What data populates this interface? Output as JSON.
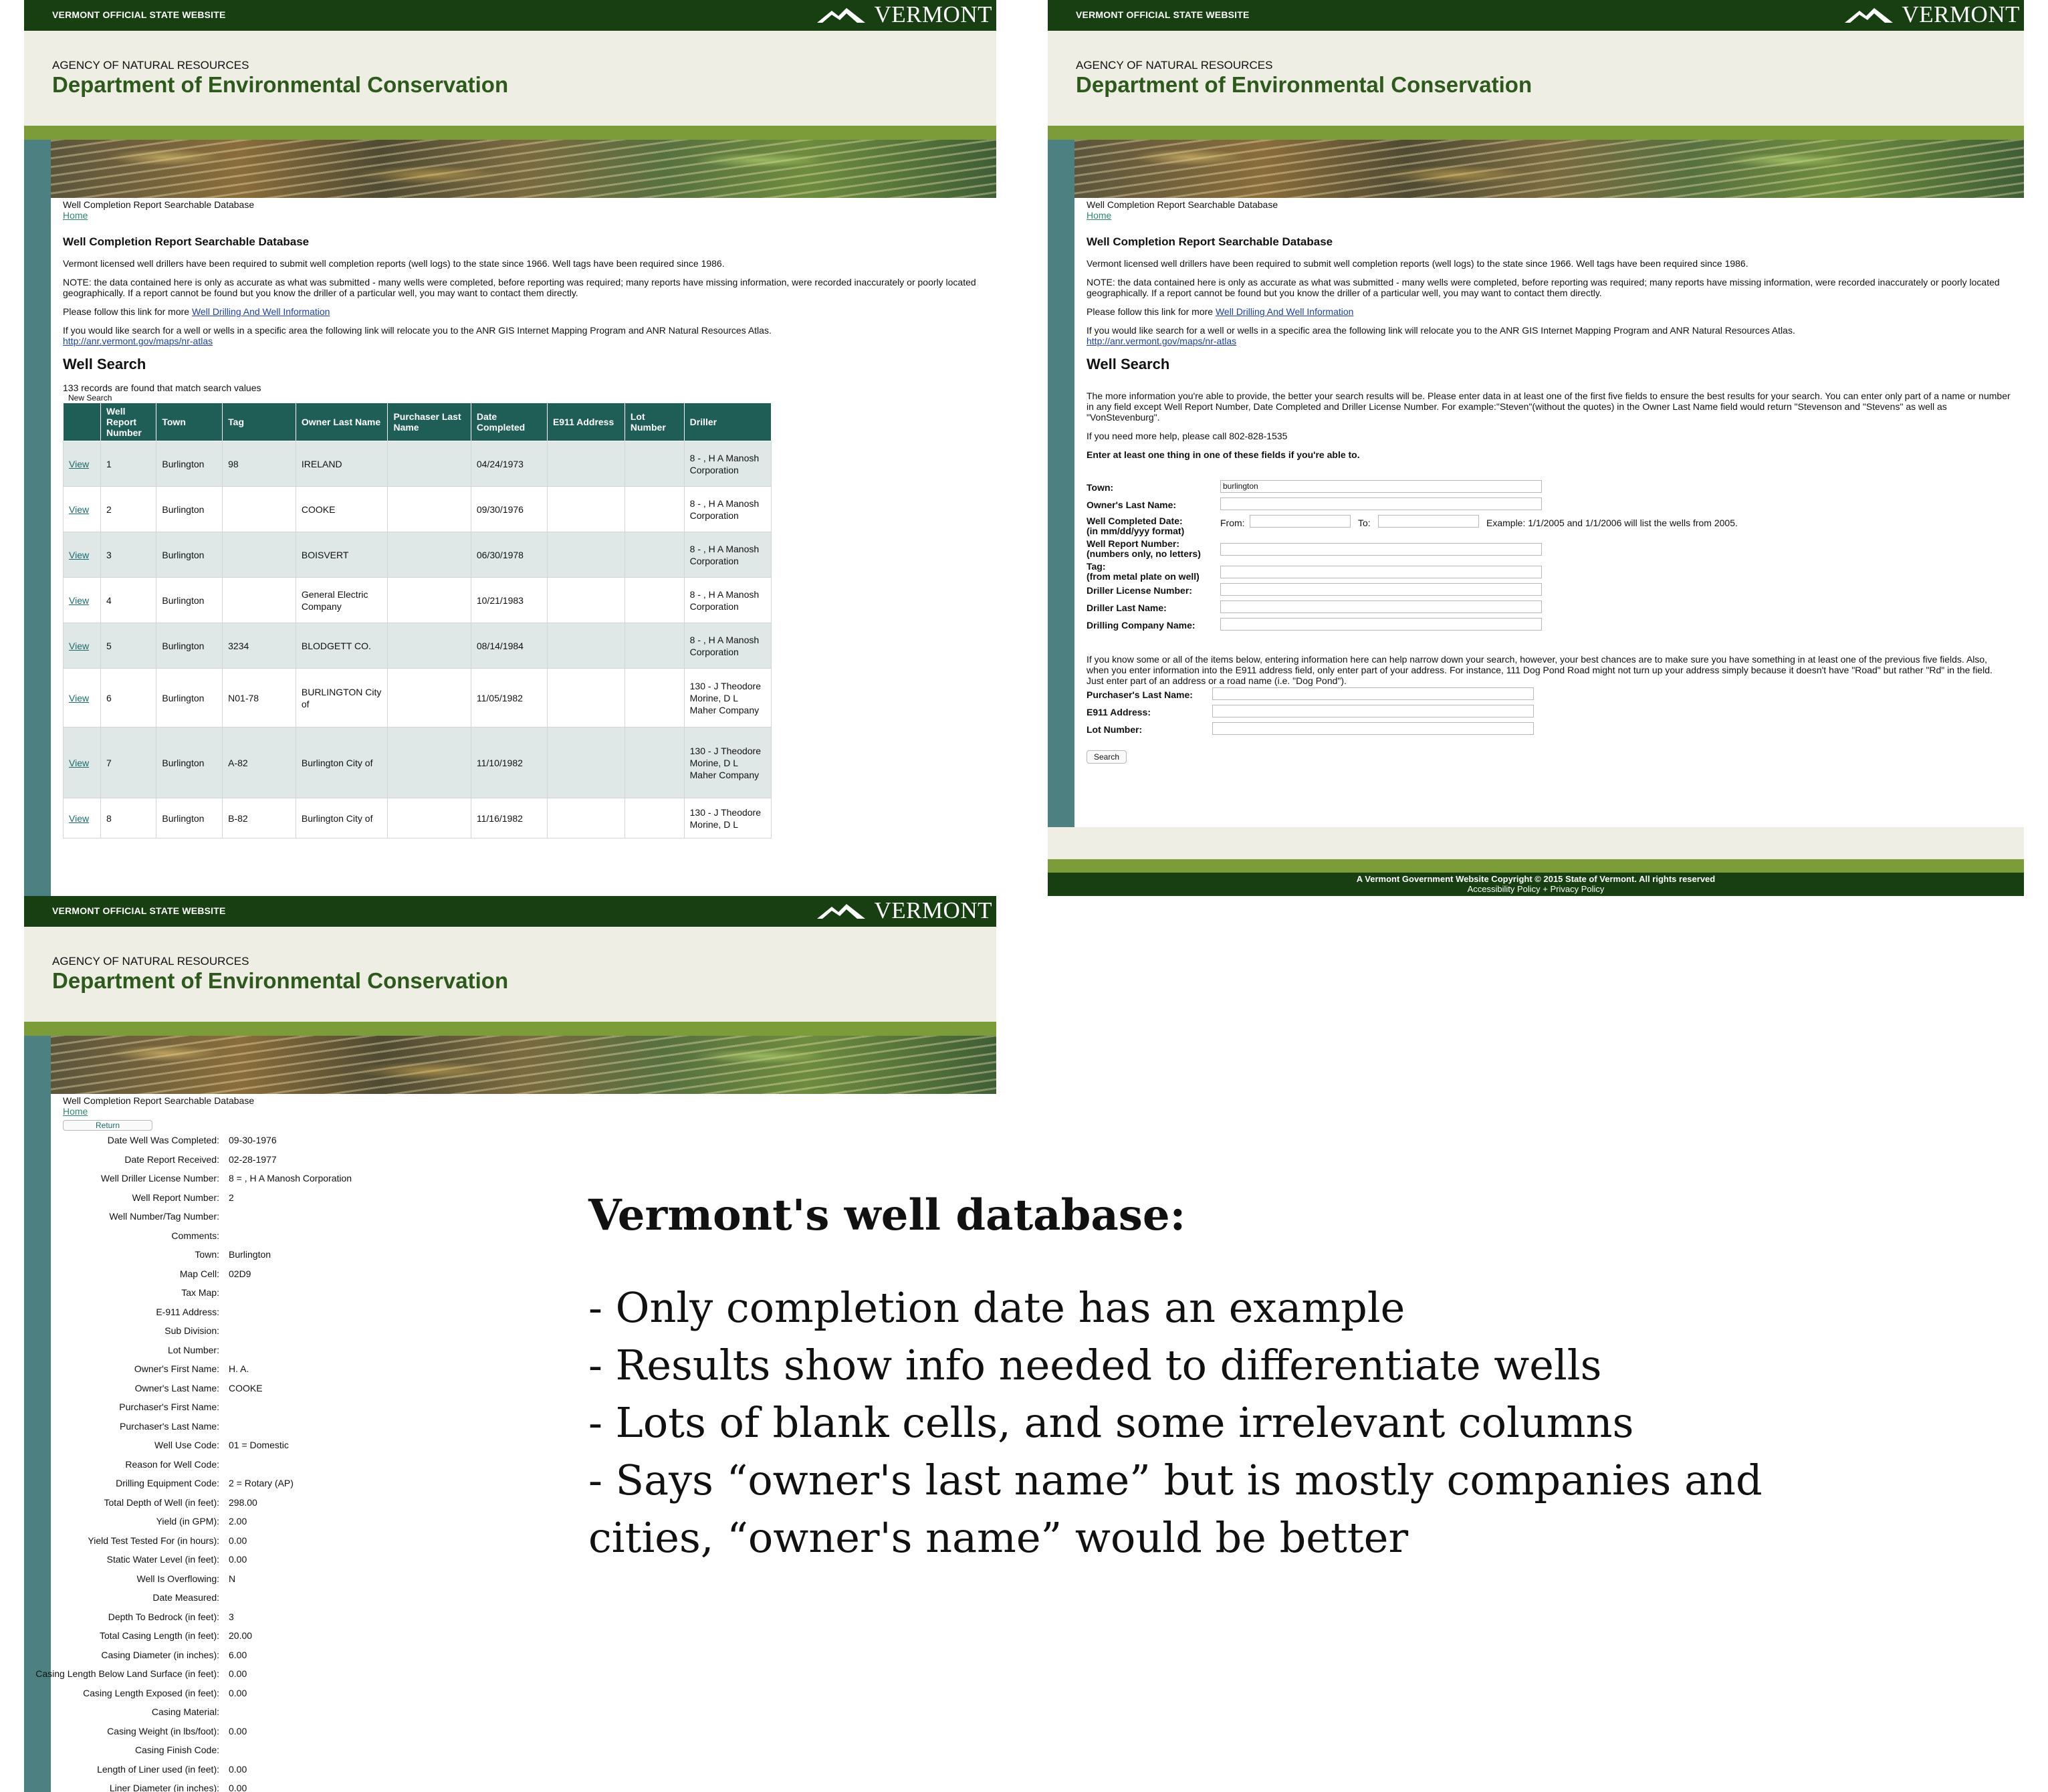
{
  "site": {
    "official": "VERMONT OFFICIAL STATE WEBSITE",
    "logo": "VERMONT",
    "agency": "AGENCY OF NATURAL RESOURCES",
    "dept": "Department of Environmental Conservation",
    "breadcrumb": "Well Completion Report Searchable Database",
    "home": "Home"
  },
  "intro": {
    "title": "Well Completion Report Searchable Database",
    "p1": "Vermont licensed well drillers have been required to submit well completion reports (well logs) to the state since 1966. Well tags have been required since 1986.",
    "p2": "NOTE: the data contained here is only as accurate as what was submitted - many wells were completed, before reporting was required; many reports have missing information, were recorded inaccurately or poorly located geographically. If a report cannot be found but you know the driller of a particular well, you may want to contact them directly.",
    "p3_pre": "Please follow this link for more ",
    "p3_link": "Well Drilling And Well Information",
    "p4": "If you would like search for a well or wells in a specific area the following link will relocate you to the ANR GIS Internet Mapping Program and ANR Natural Resources Atlas.",
    "p4_link": "http://anr.vermont.gov/maps/nr-atlas",
    "well_search": "Well Search"
  },
  "results": {
    "count_text": "133 records are found that match search values",
    "new_search": "New Search",
    "columns": [
      "",
      "Well Report Number",
      "Town",
      "Tag",
      "Owner Last Name",
      "Purchaser Last Name",
      "Date Completed",
      "E911 Address",
      "Lot Number",
      "Driller"
    ],
    "rows": [
      {
        "view": "View",
        "num": "1",
        "town": "Burlington",
        "tag": "98",
        "owner": "IRELAND",
        "purch": "",
        "date": "04/24/1973",
        "e911": "",
        "lot": "",
        "driller": "8 - , H A Manosh Corporation"
      },
      {
        "view": "View",
        "num": "2",
        "town": "Burlington",
        "tag": "",
        "owner": "COOKE",
        "purch": "",
        "date": "09/30/1976",
        "e911": "",
        "lot": "",
        "driller": "8 - , H A Manosh Corporation"
      },
      {
        "view": "View",
        "num": "3",
        "town": "Burlington",
        "tag": "",
        "owner": "BOISVERT",
        "purch": "",
        "date": "06/30/1978",
        "e911": "",
        "lot": "",
        "driller": "8 - , H A Manosh Corporation"
      },
      {
        "view": "View",
        "num": "4",
        "town": "Burlington",
        "tag": "",
        "owner": "General Electric Company",
        "purch": "",
        "date": "10/21/1983",
        "e911": "",
        "lot": "",
        "driller": "8 - , H A Manosh Corporation"
      },
      {
        "view": "View",
        "num": "5",
        "town": "Burlington",
        "tag": "3234",
        "owner": "BLODGETT CO.",
        "purch": "",
        "date": "08/14/1984",
        "e911": "",
        "lot": "",
        "driller": "8 - , H A Manosh Corporation"
      },
      {
        "view": "View",
        "num": "6",
        "town": "Burlington",
        "tag": "N01-78",
        "owner": "BURLINGTON City of",
        "purch": "",
        "date": "11/05/1982",
        "e911": "",
        "lot": "",
        "driller": "130 - J Theodore Morine, D L Maher Company"
      },
      {
        "view": "View",
        "num": "7",
        "town": "Burlington",
        "tag": "A-82",
        "owner": "Burlington City of",
        "purch": "",
        "date": "11/10/1982",
        "e911": "",
        "lot": "",
        "driller": "130 - J Theodore Morine, D L Maher Company"
      },
      {
        "view": "View",
        "num": "8",
        "town": "Burlington",
        "tag": "B-82",
        "owner": "Burlington City of",
        "purch": "",
        "date": "11/16/1982",
        "e911": "",
        "lot": "",
        "driller": "130 - J Theodore Morine, D L"
      }
    ]
  },
  "search_form": {
    "help1": "The more information you're able to provide, the better your search results will be. Please enter data in at least one of the first five fields to ensure the best results for your search. You can enter only part of a name or number in any field except Well Report Number, Date Completed and Driller License Number. For example:\"Steven\"(without the quotes) in the Owner Last Name field would return \"Stevenson and \"Stevens\" as well as \"VonStevenburg\".",
    "help2": "If you need more help, please call 802-828-1535",
    "help3": "Enter at least one thing in one of these fields if you're able to.",
    "town_label": "Town:",
    "town_value": "burlington",
    "owner_label": "Owner's Last Name:",
    "date_label": "Well Completed Date:",
    "date_label2": "(in mm/dd/yyy format)",
    "from_label": "From:",
    "to_label": "To:",
    "date_example": "Example: 1/1/2005 and 1/1/2006 will list the wells from 2005.",
    "report_label": "Well Report Number:",
    "report_label2": "(numbers only, no letters)",
    "tag_label": "Tag:",
    "tag_label2": "(from metal plate on well)",
    "license_label": "Driller License Number:",
    "driller_label": "Driller Last Name:",
    "company_label": "Drilling Company Name:",
    "help4": "If you know some or all of the items below, entering information here can help narrow down your search, however, your best chances are to make sure you have something in at least one of the previous five fields. Also, when you enter information into the E911 address field, only enter part of your address. For instance, 111 Dog Pond Road might not turn up your address simply because it doesn't have \"Road\" but rather \"Rd\" in the field. Just enter part of an address or a road name (i.e. \"Dog Pond\").",
    "purchaser_label": "Purchaser's Last Name:",
    "e911_label": "E911 Address:",
    "lot_label": "Lot Number:",
    "search_button": "Search",
    "footer1": "A Vermont Government Website Copyright © 2015 State of Vermont. All rights reserved",
    "footer2": "Accessibility Policy + Privacy Policy"
  },
  "detail": {
    "return": "Return",
    "fields": [
      {
        "label": "Date Well Was Completed:",
        "value": "09-30-1976"
      },
      {
        "label": "Date Report Received:",
        "value": "02-28-1977"
      },
      {
        "label": "Well Driller License Number:",
        "value": "8 = , H A Manosh Corporation"
      },
      {
        "label": "Well Report Number:",
        "value": "2"
      },
      {
        "label": "Well Number/Tag Number:",
        "value": ""
      },
      {
        "label": "Comments:",
        "value": ""
      },
      {
        "label": "Town:",
        "value": "Burlington"
      },
      {
        "label": "Map Cell:",
        "value": "02D9"
      },
      {
        "label": "Tax Map:",
        "value": ""
      },
      {
        "label": "E-911 Address:",
        "value": ""
      },
      {
        "label": "Sub Division:",
        "value": ""
      },
      {
        "label": "Lot Number:",
        "value": ""
      },
      {
        "label": "Owner's First Name:",
        "value": "H. A."
      },
      {
        "label": "Owner's Last Name:",
        "value": "COOKE"
      },
      {
        "label": "Purchaser's First Name:",
        "value": ""
      },
      {
        "label": "Purchaser's Last Name:",
        "value": ""
      },
      {
        "label": "Well Use Code:",
        "value": "01 = Domestic"
      },
      {
        "label": "Reason for Well Code:",
        "value": ""
      },
      {
        "label": "Drilling Equipment Code:",
        "value": "2 = Rotary (AP)"
      },
      {
        "label": "Total Depth of Well (in feet):",
        "value": "298.00"
      },
      {
        "label": "Yield (in GPM):",
        "value": "2.00"
      },
      {
        "label": "Yield Test Tested For (in hours):",
        "value": "0.00"
      },
      {
        "label": "Static Water Level (in feet):",
        "value": "0.00"
      },
      {
        "label": "Well Is Overflowing:",
        "value": "N"
      },
      {
        "label": "Date Measured:",
        "value": ""
      },
      {
        "label": "Depth To Bedrock (in feet):",
        "value": "3"
      },
      {
        "label": "Total Casing Length (in feet):",
        "value": "20.00"
      },
      {
        "label": "Casing Diameter (in inches):",
        "value": "6.00"
      },
      {
        "label": "Casing Length Below Land Surface (in feet):",
        "value": "0.00"
      },
      {
        "label": "Casing Length Exposed (in feet):",
        "value": "0.00"
      },
      {
        "label": "Casing Material:",
        "value": ""
      },
      {
        "label": "Casing Weight (in lbs/foot):",
        "value": "0.00"
      },
      {
        "label": "Casing Finish Code:",
        "value": ""
      },
      {
        "label": "Length of Liner used (in feet):",
        "value": "0.00"
      },
      {
        "label": "Liner Diameter (in inches):",
        "value": "0.00"
      }
    ]
  },
  "caption": {
    "title": "Vermont's well database:",
    "lines": [
      "- Only completion date has an example",
      "- Results show info needed to differentiate wells",
      "- Lots of blank cells, and some irrelevant columns",
      "- Says “owner's last name” but is mostly companies and",
      "cities, “owner's name” would be better"
    ]
  }
}
